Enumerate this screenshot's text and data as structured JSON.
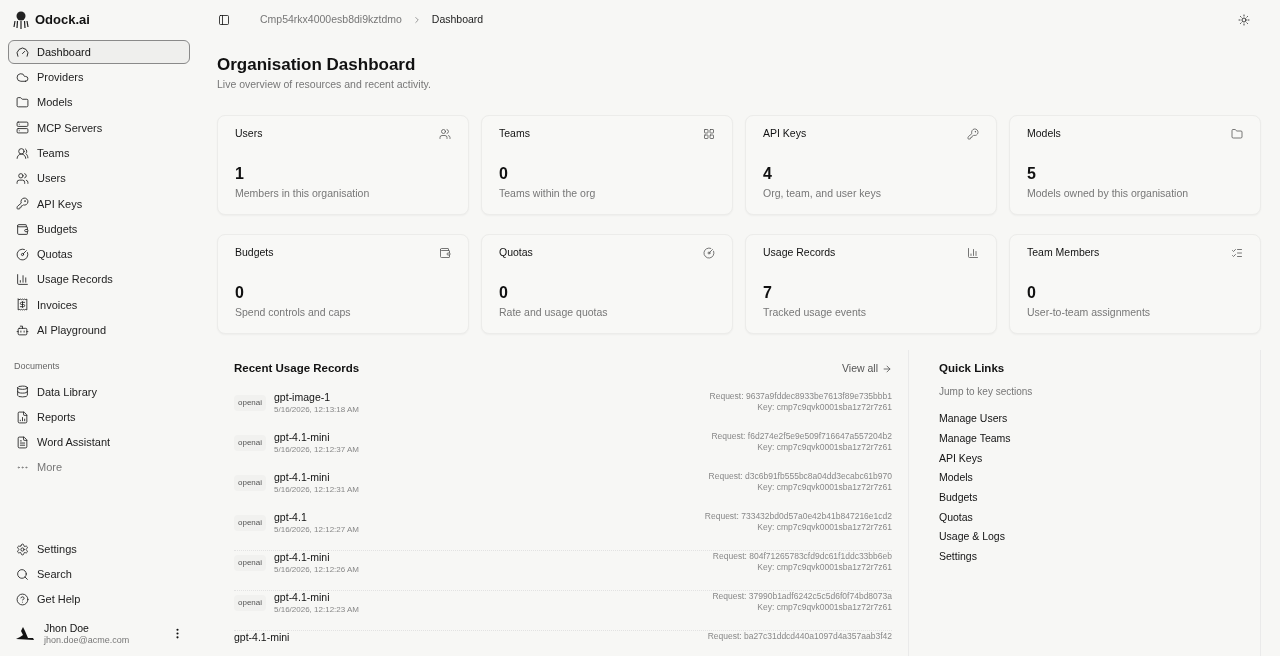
{
  "brand": {
    "name": "Odock.ai"
  },
  "nav": [
    {
      "label": "Dashboard",
      "selected": true
    },
    {
      "label": "Providers",
      "selected": false
    },
    {
      "label": "Models",
      "selected": false
    },
    {
      "label": "MCP Servers",
      "selected": false
    },
    {
      "label": "Teams",
      "selected": false
    },
    {
      "label": "Users",
      "selected": false
    },
    {
      "label": "API Keys",
      "selected": false
    },
    {
      "label": "Budgets",
      "selected": false
    },
    {
      "label": "Quotas",
      "selected": false
    },
    {
      "label": "Usage Records",
      "selected": false
    },
    {
      "label": "Invoices",
      "selected": false
    },
    {
      "label": "AI Playground",
      "selected": false
    }
  ],
  "documents": {
    "heading": "Documents",
    "items": [
      {
        "label": "Data Library"
      },
      {
        "label": "Reports"
      },
      {
        "label": "Word Assistant"
      },
      {
        "label": "More"
      }
    ]
  },
  "footer_nav": [
    {
      "label": "Settings"
    },
    {
      "label": "Search"
    },
    {
      "label": "Get Help"
    }
  ],
  "user": {
    "name": "Jhon Doe",
    "email": "jhon.doe@acme.com"
  },
  "breadcrumb": [
    "Cmp54rkx4000esb8di9kztdmo",
    "Dashboard"
  ],
  "page": {
    "title": "Organisation Dashboard",
    "subtitle": "Live overview of resources and recent activity."
  },
  "stats": [
    {
      "title": "Users",
      "value": "1",
      "caption": "Members in this organisation"
    },
    {
      "title": "Teams",
      "value": "0",
      "caption": "Teams within the org"
    },
    {
      "title": "API Keys",
      "value": "4",
      "caption": "Org, team, and user keys"
    },
    {
      "title": "Models",
      "value": "5",
      "caption": "Models owned by this organisation"
    },
    {
      "title": "Budgets",
      "value": "0",
      "caption": "Spend controls and caps"
    },
    {
      "title": "Quotas",
      "value": "0",
      "caption": "Rate and usage quotas"
    },
    {
      "title": "Usage Records",
      "value": "7",
      "caption": "Tracked usage events"
    },
    {
      "title": "Team Members",
      "value": "0",
      "caption": "User-to-team assignments"
    }
  ],
  "recent": {
    "title": "Recent Usage Records",
    "view_all": "View all",
    "rows": [
      {
        "provider": "openai",
        "model": "gpt-image-1",
        "time": "5/16/2026, 12:13:18 AM",
        "request": "Request: 9637a9fddec8933be7613f89e735bbb1",
        "key": "Key: cmp7c9qvk0001sba1z72r7z61"
      },
      {
        "provider": "openai",
        "model": "gpt-4.1-mini",
        "time": "5/16/2026, 12:12:37 AM",
        "request": "Request: f6d274e2f5e9e509f716647a557204b2",
        "key": "Key: cmp7c9qvk0001sba1z72r7z61"
      },
      {
        "provider": "openai",
        "model": "gpt-4.1-mini",
        "time": "5/16/2026, 12:12:31 AM",
        "request": "Request: d3c6b91fb555bc8a04dd3ecabc61b970",
        "key": "Key: cmp7c9qvk0001sba1z72r7z61"
      },
      {
        "provider": "openai",
        "model": "gpt-4.1",
        "time": "5/16/2026, 12:12:27 AM",
        "request": "Request: 733432bd0d57a0e42b41b847216e1cd2",
        "key": "Key: cmp7c9qvk0001sba1z72r7z61"
      },
      {
        "provider": "openai",
        "model": "gpt-4.1-mini",
        "time": "5/16/2026, 12:12:26 AM",
        "request": "Request: 804f71265783cfd9dc61f1ddc33bb6eb",
        "key": "Key: cmp7c9qvk0001sba1z72r7z61"
      },
      {
        "provider": "openai",
        "model": "gpt-4.1-mini",
        "time": "5/16/2026, 12:12:23 AM",
        "request": "Request: 37990b1adf6242c5c5d6f0f74bd8073a",
        "key": "Key: cmp7c9qvk0001sba1z72r7z61"
      },
      {
        "model": "gpt-4.1-mini",
        "request": "Request: ba27c31ddcd440a1097d4a357aab3f42"
      }
    ]
  },
  "quick_links": {
    "title": "Quick Links",
    "subtitle": "Jump to key sections",
    "links": [
      "Manage Users",
      "Manage Teams",
      "API Keys",
      "Models",
      "Budgets",
      "Quotas",
      "Usage & Logs",
      "Settings"
    ]
  }
}
